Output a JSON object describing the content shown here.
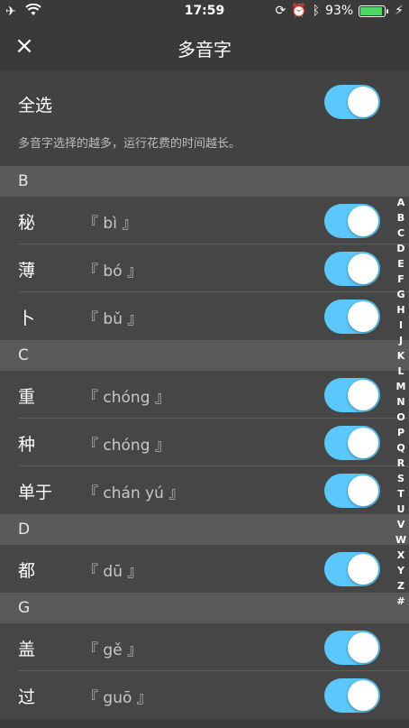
{
  "status_bar": {
    "time": "17:59",
    "battery_percent": "93%",
    "battery_level": 0.93,
    "icons": [
      "airplane-icon",
      "wifi-icon",
      "orientation-lock-icon",
      "alarm-icon",
      "bluetooth-icon",
      "battery-icon",
      "charging-icon"
    ]
  },
  "nav": {
    "title": "多音字",
    "close_icon": "×"
  },
  "select_all": {
    "label": "全选",
    "description": "多音字选择的越多，运行花费的时间越长。",
    "toggle_on": true
  },
  "sections": [
    {
      "letter": "B",
      "items": [
        {
          "char": "秘",
          "pinyin": "『 bì 』",
          "on": true
        },
        {
          "char": "薄",
          "pinyin": "『 bó 』",
          "on": true
        },
        {
          "char": "卜",
          "pinyin": "『 bǔ 』",
          "on": true
        }
      ]
    },
    {
      "letter": "C",
      "items": [
        {
          "char": "重",
          "pinyin": "『 chóng 』",
          "on": true
        },
        {
          "char": "种",
          "pinyin": "『 chóng 』",
          "on": true
        },
        {
          "char": "单于",
          "pinyin": "『 chán yú 』",
          "on": true
        }
      ]
    },
    {
      "letter": "D",
      "items": [
        {
          "char": "都",
          "pinyin": "『 dū 』",
          "on": true
        }
      ]
    },
    {
      "letter": "G",
      "items": [
        {
          "char": "盖",
          "pinyin": "『 gě 』",
          "on": true
        },
        {
          "char": "过",
          "pinyin": "『 guō 』",
          "on": true
        }
      ]
    }
  ],
  "index_letters": [
    "A",
    "B",
    "C",
    "D",
    "E",
    "F",
    "G",
    "H",
    "I",
    "J",
    "K",
    "L",
    "M",
    "N",
    "O",
    "P",
    "Q",
    "R",
    "S",
    "T",
    "U",
    "V",
    "W",
    "X",
    "Y",
    "Z",
    "#"
  ],
  "colors": {
    "accent": "#5ac8fa",
    "battery": "#4cd964",
    "background": "#3c3c3c"
  }
}
